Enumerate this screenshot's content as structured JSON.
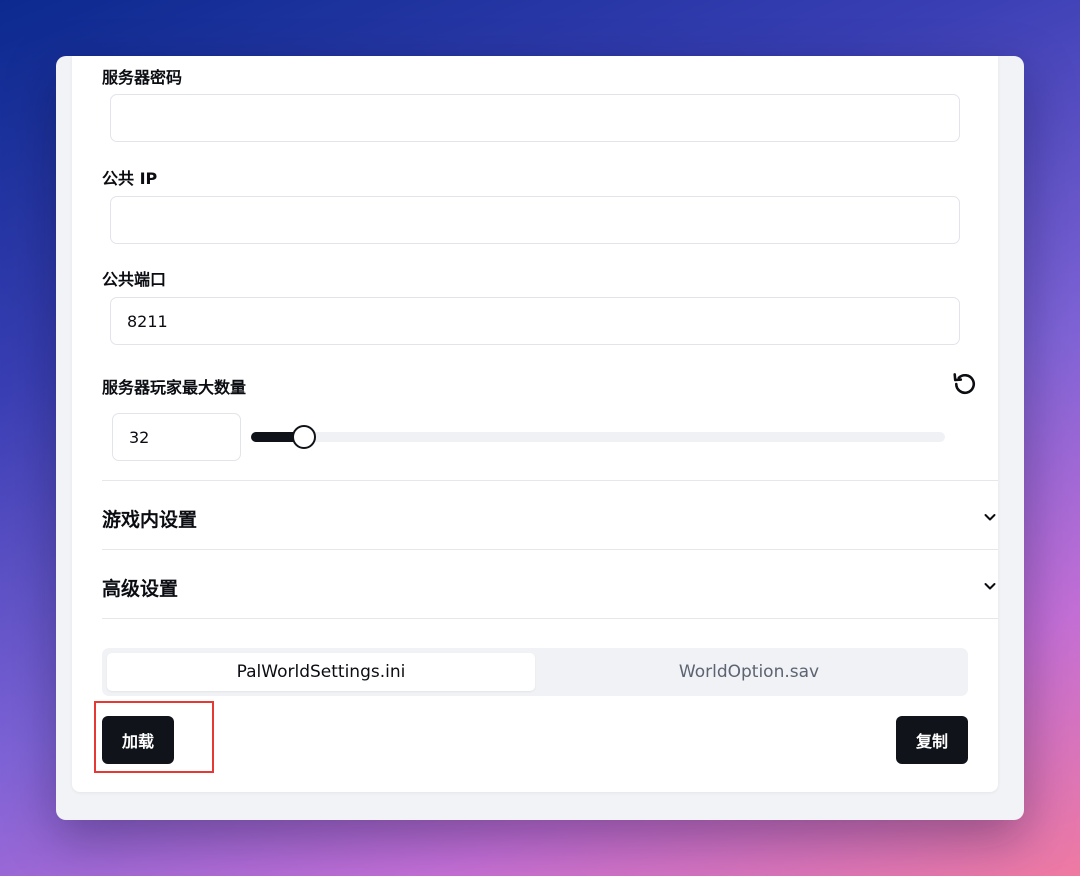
{
  "form": {
    "server_password": {
      "label": "服务器密码",
      "value": "",
      "placeholder": ""
    },
    "public_ip": {
      "label": "公共 IP",
      "value": "",
      "placeholder": ""
    },
    "public_port": {
      "label": "公共端口",
      "value": "8211"
    },
    "max_players": {
      "label": "服务器玩家最大数量",
      "value": "32",
      "slider_fraction": 0.077,
      "reset_icon": "rotate-ccw-icon"
    }
  },
  "sections": {
    "in_game": {
      "title": "游戏内设置",
      "icon": "chevron-down-icon",
      "expanded": false
    },
    "advanced": {
      "title": "高级设置",
      "icon": "chevron-down-icon",
      "expanded": false
    }
  },
  "tabs": [
    {
      "label": "PalWorldSettings.ini",
      "active": true
    },
    {
      "label": "WorldOption.sav",
      "active": false
    }
  ],
  "actions": {
    "load_label": "加载",
    "copy_label": "复制"
  },
  "colors": {
    "primary_button": "#10131a",
    "highlight_box": "#e53935",
    "tab_inactive_text": "#5c6372"
  }
}
